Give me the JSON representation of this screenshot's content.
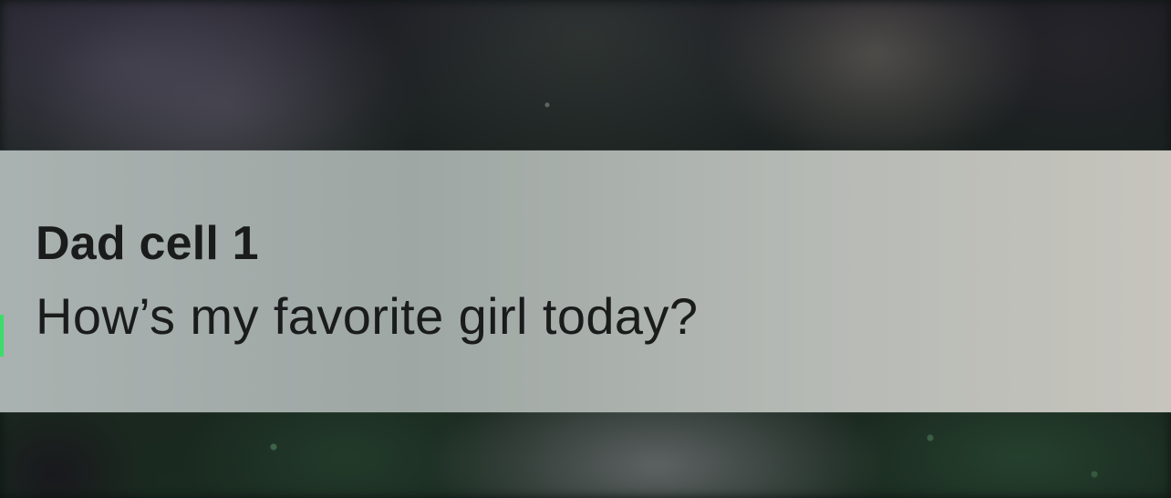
{
  "notification": {
    "sender": "Dad cell 1",
    "message": "How’s my favorite girl today?"
  },
  "colors": {
    "banner": "#a9b2b0",
    "text": "#1a1c1c",
    "accent": "#3ddc6a"
  }
}
